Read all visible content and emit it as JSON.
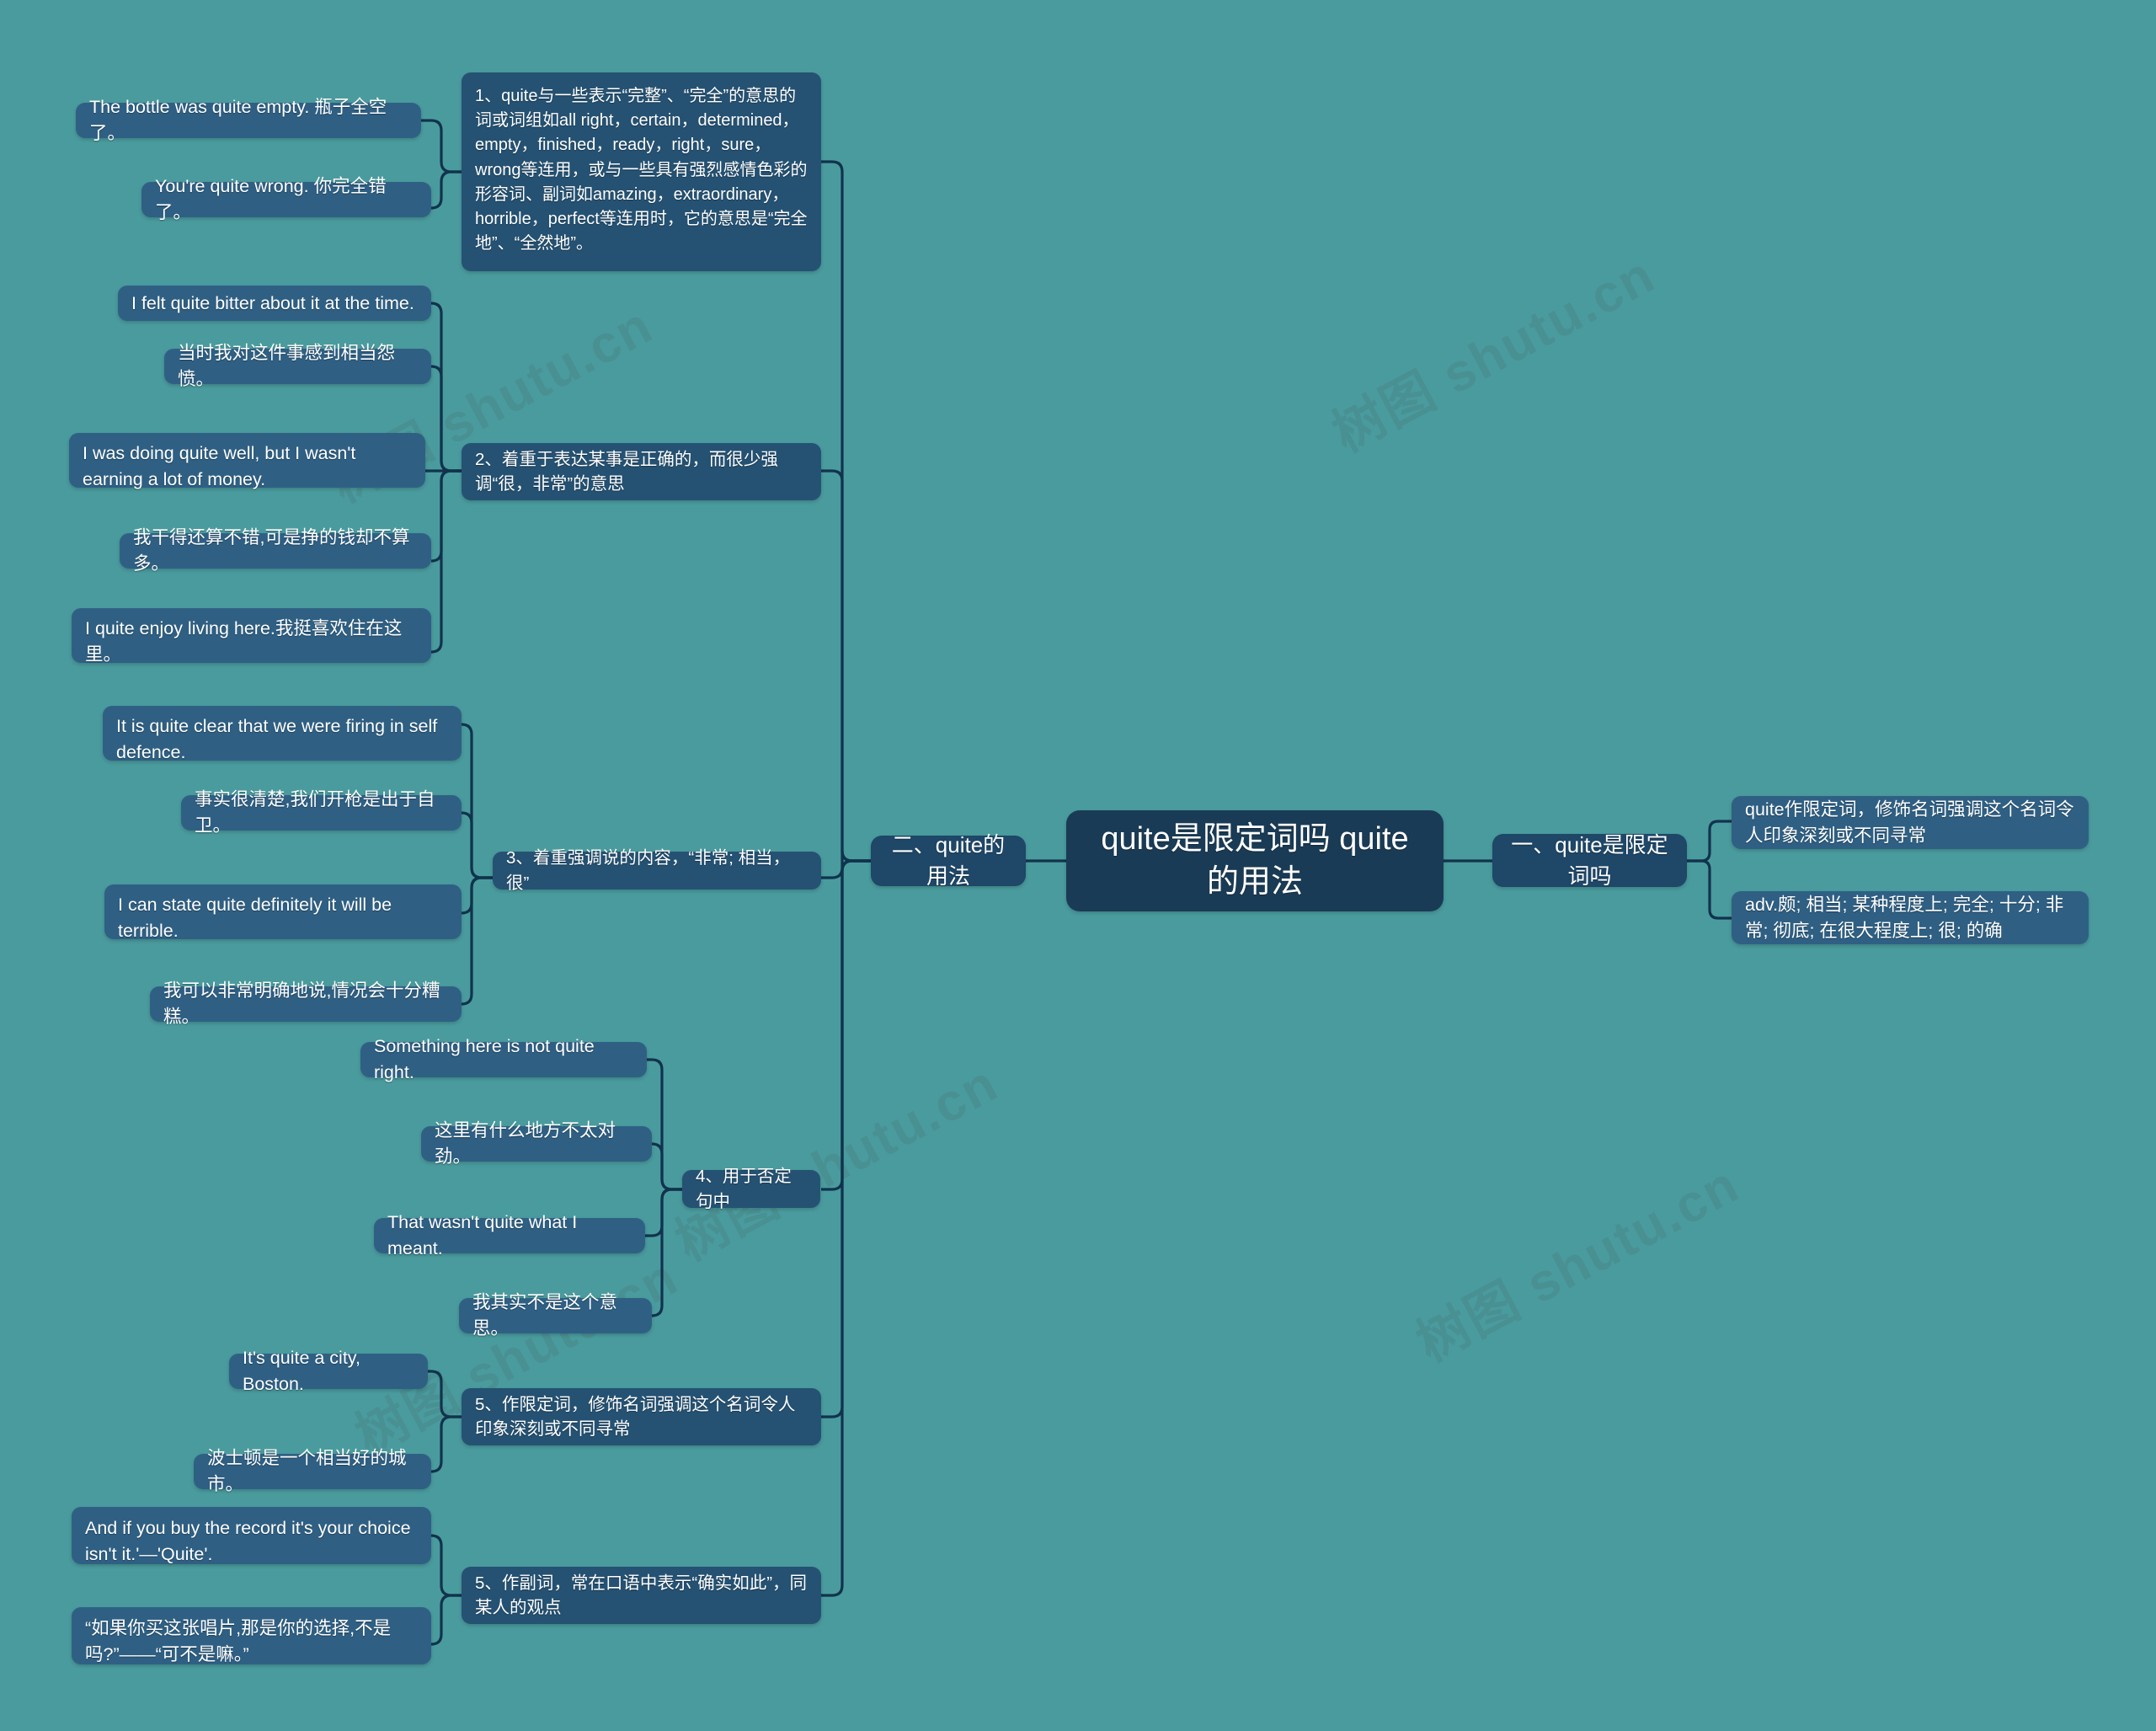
{
  "meta": {
    "background_color": "#4a9b9e",
    "node_color": "#2f6084",
    "branch_color": "#255273",
    "level1_color": "#1e4768",
    "root_color": "#1a3b55",
    "link_color": "#11334d",
    "watermark_text": "树图 shutu.cn"
  },
  "root": {
    "label": "quite是限定词吗 quite的用法"
  },
  "watermarks": [
    {
      "text": "树图 shutu.cn"
    },
    {
      "text": "树图 shutu.cn"
    },
    {
      "text": "树图 shutu.cn"
    },
    {
      "text": "树图 shutu.cn"
    },
    {
      "text": "树图 shutu.cn"
    }
  ],
  "right_branch": {
    "label": "一、quite是限定词吗",
    "children": [
      {
        "label": "quite作限定词，修饰名词强调这个名词令人印象深刻或不同寻常"
      },
      {
        "label": "adv.颇; 相当; 某种程度上; 完全; 十分; 非常; 彻底; 在很大程度上; 很; 的确"
      }
    ]
  },
  "left_branch": {
    "label": "二、quite的用法",
    "topics": [
      {
        "label": "1、quite与一些表示“完整”、“完全”的意思的词或词组如all right，certain，determined，empty，finished，ready，right，sure，wrong等连用，或与一些具有强烈感情色彩的形容词、副词如amazing，extraordinary，horrible，perfect等连用时，它的意思是“完全地”、“全然地”。",
        "examples": [
          {
            "label": "The bottle was quite empty.  瓶子全空了。"
          },
          {
            "label": "You're quite wrong.  你完全错了。"
          }
        ]
      },
      {
        "label": "2、着重于表达某事是正确的，而很少强调“很，非常”的意思",
        "examples": [
          {
            "label": "I felt quite bitter about it at the time."
          },
          {
            "label": "当时我对这件事感到相当怨愤。"
          },
          {
            "label": "I was doing quite well, but I wasn't earning a lot of money."
          },
          {
            "label": "我干得还算不错,可是挣的钱却不算多。"
          },
          {
            "label": "I quite enjoy living here.我挺喜欢住在这里。"
          }
        ]
      },
      {
        "label": "3、着重强调说的内容，“非常; 相当，很”",
        "examples": [
          {
            "label": "It is quite clear that we were firing in self defence."
          },
          {
            "label": "事实很清楚,我们开枪是出于自卫。"
          },
          {
            "label": "I can state quite definitely it will be terrible."
          },
          {
            "label": "我可以非常明确地说,情况会十分糟糕。"
          }
        ]
      },
      {
        "label": "4、用于否定句中",
        "examples": [
          {
            "label": "Something here is not quite right."
          },
          {
            "label": "这里有什么地方不太对劲。"
          },
          {
            "label": "That wasn't quite what I meant."
          },
          {
            "label": "我其实不是这个意思。"
          }
        ]
      },
      {
        "label": "5、作限定词，修饰名词强调这个名词令人印象深刻或不同寻常",
        "examples": [
          {
            "label": "It's quite a city, Boston."
          },
          {
            "label": "波士顿是一个相当好的城市。"
          }
        ]
      },
      {
        "label": "5、作副词，常在口语中表示“确实如此”，同某人的观点",
        "examples": [
          {
            "label": "And if you buy the record it's your choice isn't it.'—'Quite'."
          },
          {
            "label": "“如果你买这张唱片,那是你的选择,不是吗?”——“可不是嘛。”"
          }
        ]
      }
    ]
  }
}
